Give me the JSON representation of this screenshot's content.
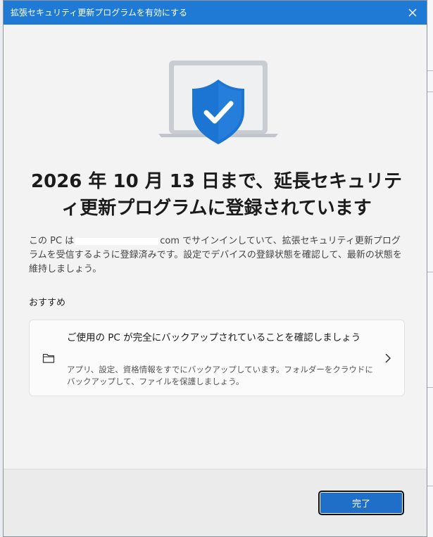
{
  "window": {
    "title": "拡張セキュリティ更新プログラムを有効にする"
  },
  "hero": {
    "icon": "laptop-shield-check",
    "accent": "#1c74d3"
  },
  "headline": "2026 年 10 月 13 日まで、延長セキュリティ更新プログラムに登録されています",
  "description": {
    "prefix": "この PC は",
    "suffix": "com でサインインしていて、拡張セキュリティ更新プログラムを受信するように登録済みです。設定でデバイスの登録状態を確認して、最新の状態を維持しましょう。"
  },
  "recommendations": {
    "label": "おすすめ",
    "card": {
      "icon": "folder-icon",
      "title": "ご使用の PC が完全にバックアップされていることを確認しましょう",
      "description": "アプリ、設定、資格情報をすでにバックアップしています。フォルダーをクラウドにバックアップして、ファイルを保護しましょう。"
    }
  },
  "footer": {
    "done_label": "完了"
  }
}
